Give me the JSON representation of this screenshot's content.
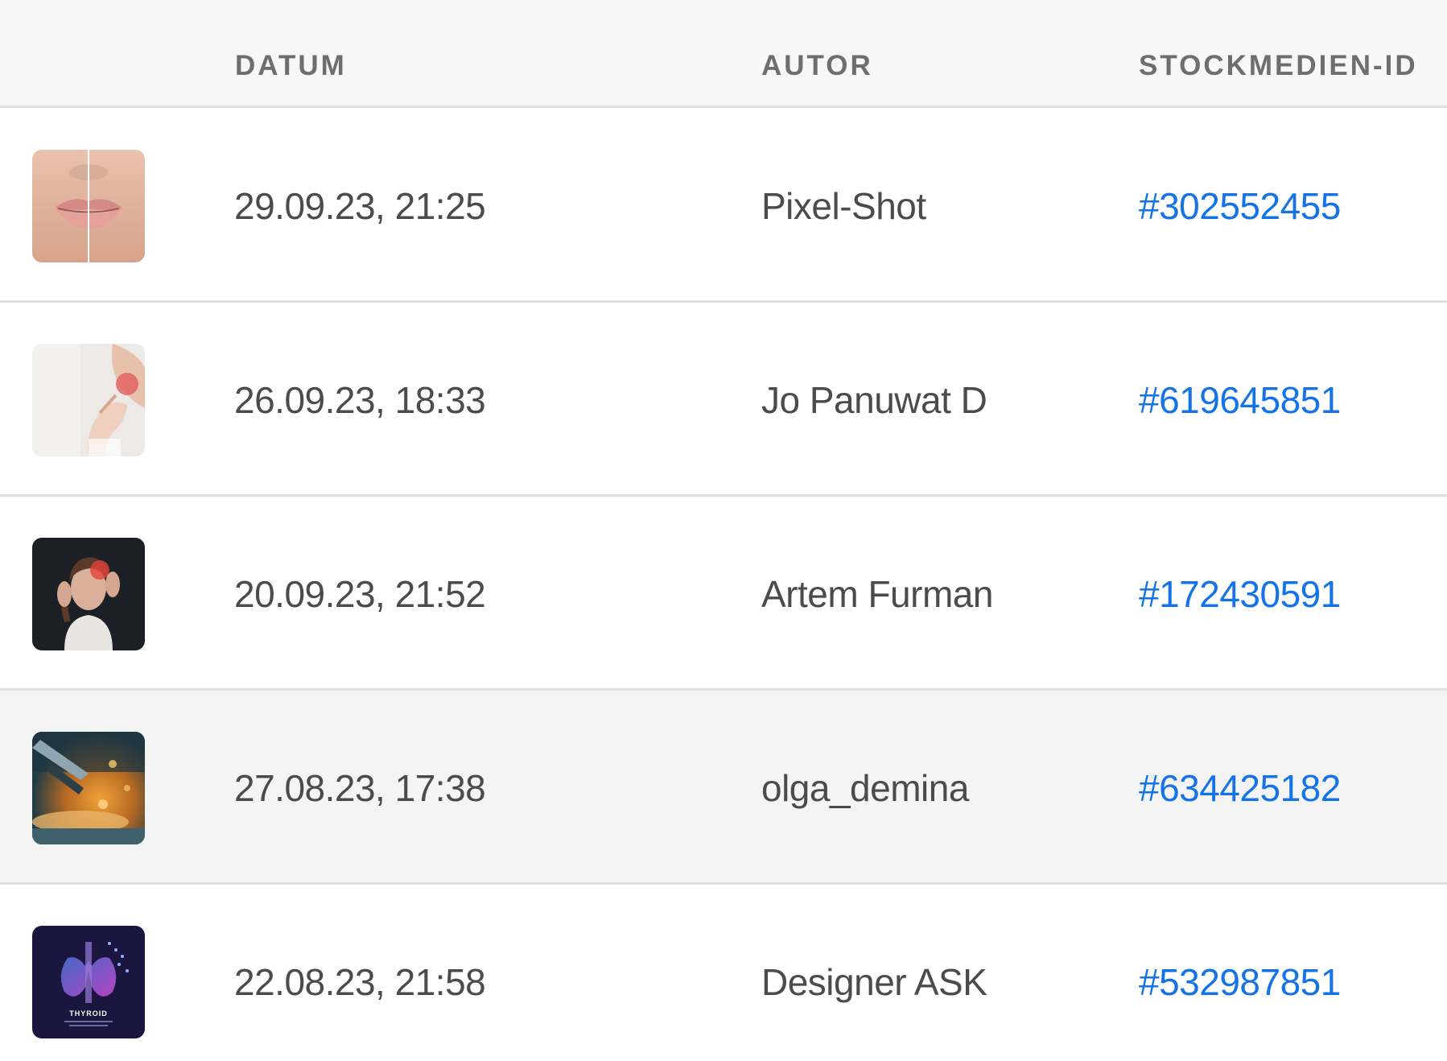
{
  "header": {
    "date_label": "DATUM",
    "author_label": "AUTOR",
    "id_label": "STOCKMEDIEN-ID"
  },
  "rows": [
    {
      "thumbnail": "lips-photo",
      "date": "29.09.23, 21:25",
      "author": "Pixel-Shot",
      "stock_id": "#302552455"
    },
    {
      "thumbnail": "sore-throat-photo",
      "date": "26.09.23, 18:33",
      "author": "Jo Panuwat D",
      "stock_id": "#619645851"
    },
    {
      "thumbnail": "headache-photo",
      "date": "20.09.23, 21:52",
      "author": "Artem Furman",
      "stock_id": "#172430591"
    },
    {
      "thumbnail": "microscope-photo",
      "date": "27.08.23, 17:38",
      "author": "olga_demina",
      "stock_id": "#634425182"
    },
    {
      "thumbnail": "thyroid-illustration",
      "thumbnail_text": "THYROID",
      "date": "22.08.23, 21:58",
      "author": "Designer ASK",
      "stock_id": "#532987851"
    }
  ],
  "colors": {
    "link": "#1473e6",
    "text": "#4b4b4b",
    "header_text": "#6e6e6e",
    "header_bg": "#f7f7f7",
    "hover_row_bg": "#f4f4f4"
  }
}
